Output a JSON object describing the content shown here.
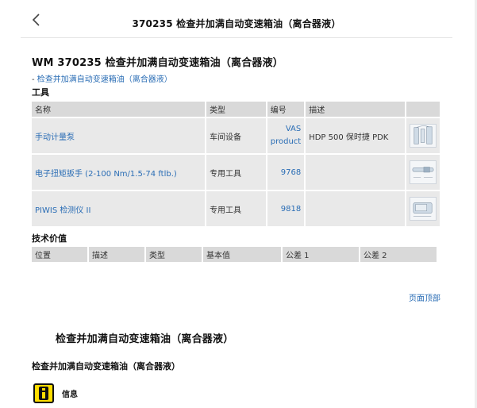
{
  "header": {
    "title": "370235 检查并加满自动变速箱油（离合器液）"
  },
  "document": {
    "title": "WM 370235 检查并加满自动变速箱油（离合器液）",
    "breadcrumb_dash": "-",
    "breadcrumb_link": "检查并加满自动变速箱油（离合器液）"
  },
  "tools": {
    "label": "工具",
    "columns": [
      "名称",
      "类型",
      "编号",
      "描述",
      ""
    ],
    "rows": [
      {
        "name": "手动计量泵",
        "type": "车间设备",
        "number": "VAS product",
        "description": "HDP 500 保时捷 PDK"
      },
      {
        "name": "电子扭矩扳手 (2-100 Nm/1.5-74 ftlb.)",
        "type": "专用工具",
        "number": "9768",
        "description": ""
      },
      {
        "name": "PIWIS 检测仪 II",
        "type": "专用工具",
        "number": "9818",
        "description": ""
      }
    ]
  },
  "tech_values": {
    "label": "技术价值",
    "columns": [
      "位置",
      "描述",
      "类型",
      "基本值",
      "公差 1",
      "公差 2"
    ]
  },
  "page_top": "页面顶部",
  "section": {
    "title": "检查并加满自动变速箱油（离合器液）",
    "heading": "检查并加满自动变速箱油（离合器液）",
    "info_label": "信息"
  },
  "colors": {
    "link": "#2a6db5",
    "header_cell": "#d9d9d9",
    "cell": "#e9e9e9",
    "info_yellow": "#ffdd00"
  }
}
